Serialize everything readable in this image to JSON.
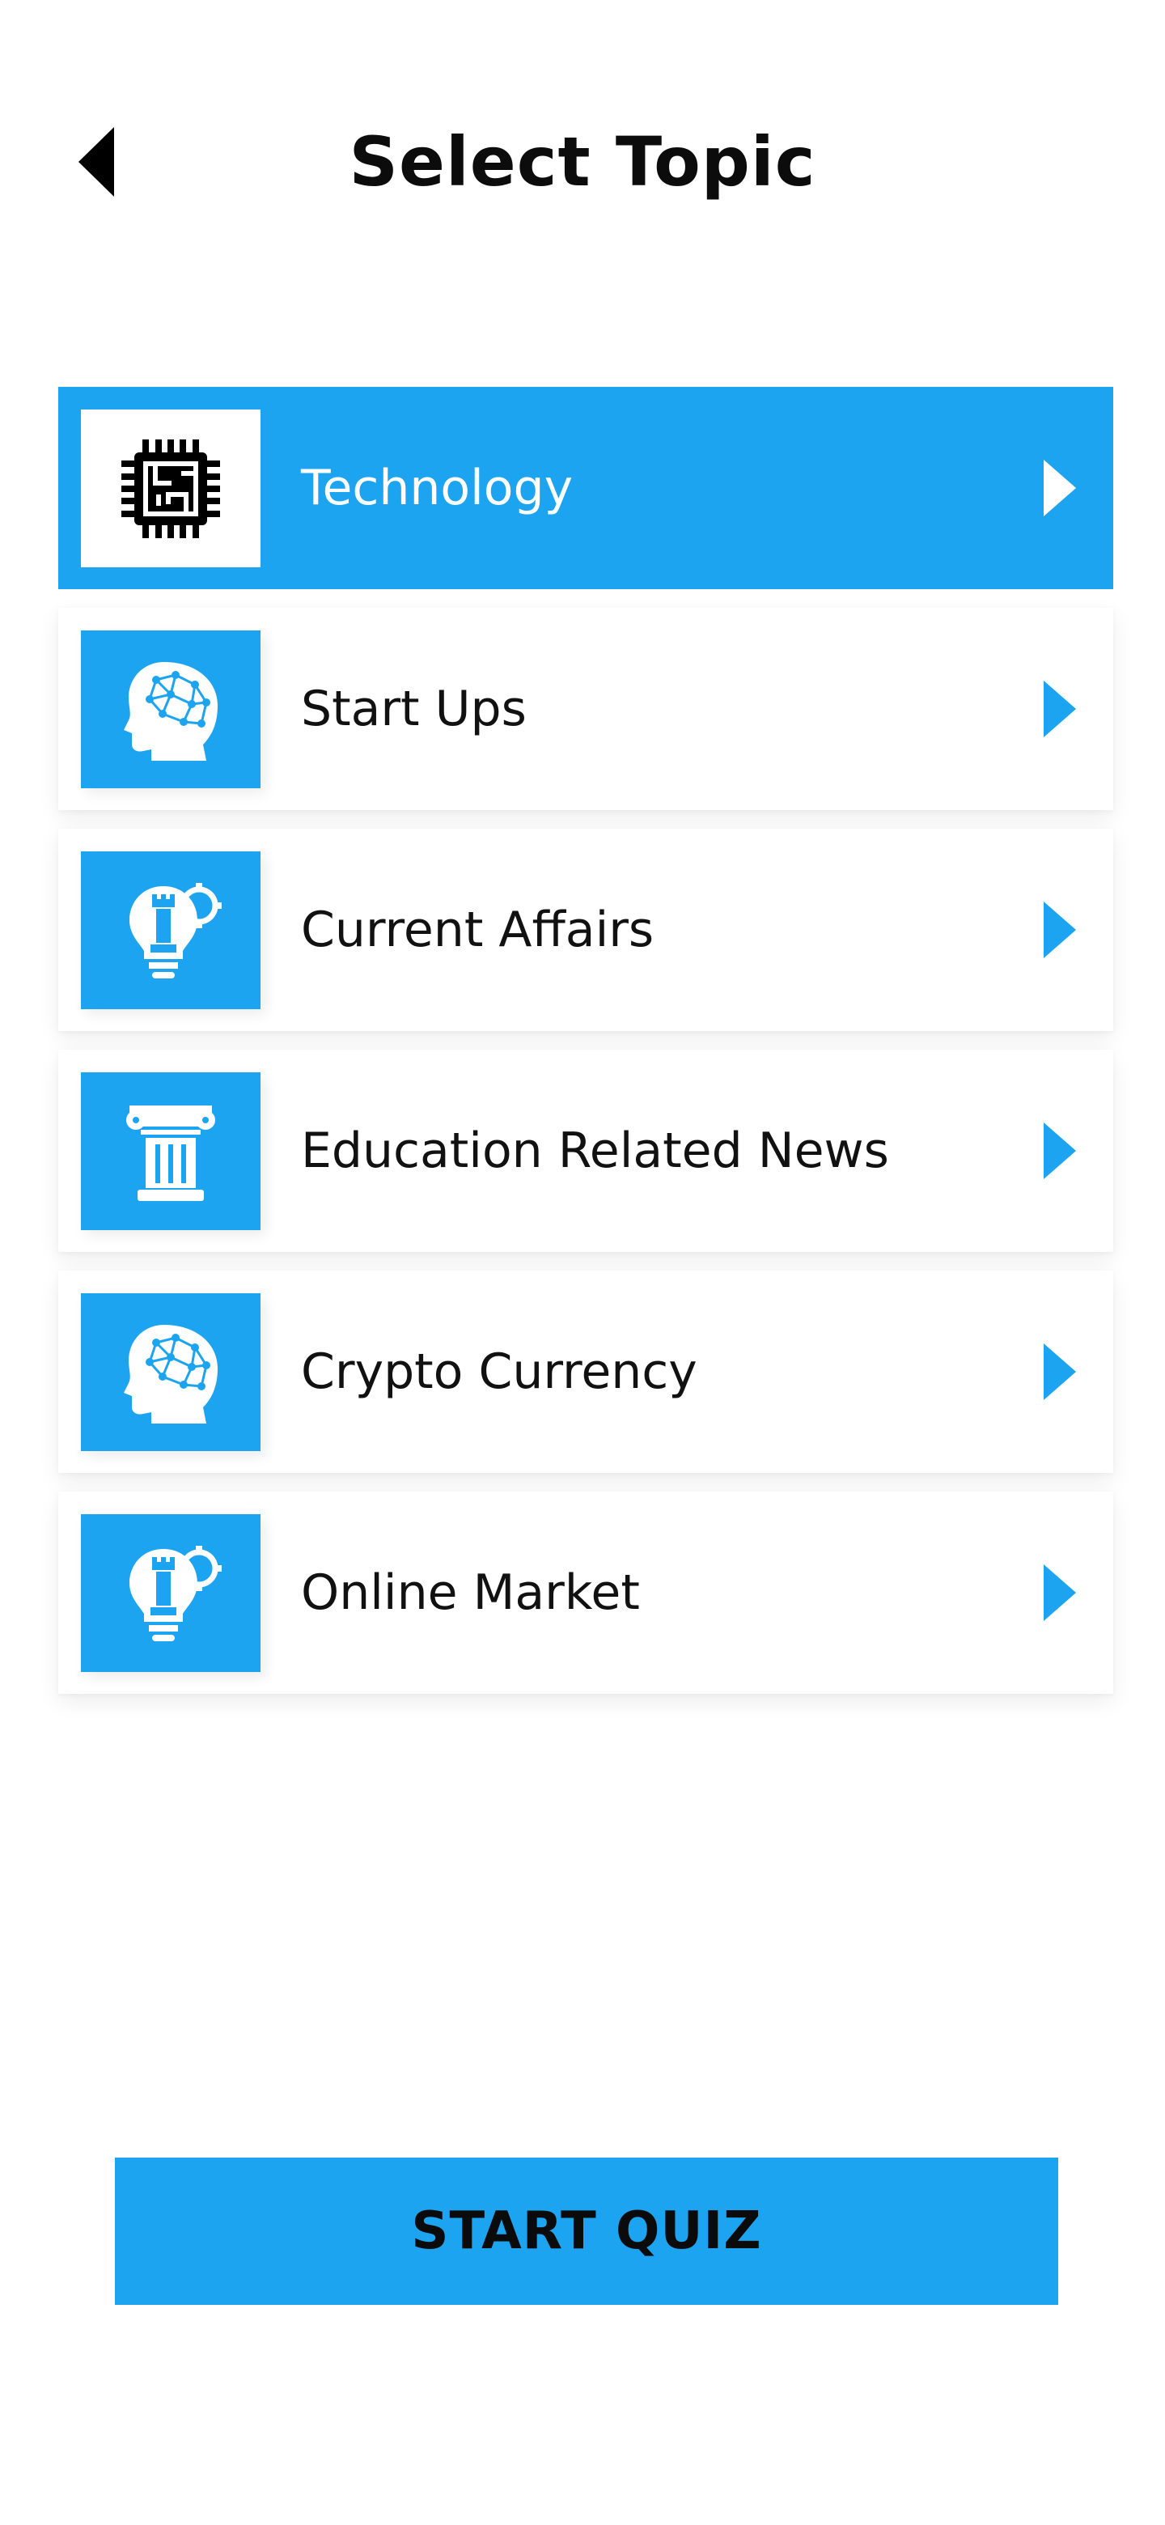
{
  "header": {
    "title": "Select Topic",
    "back_icon": "back-arrow-icon"
  },
  "topics": [
    {
      "label": "Technology",
      "icon": "cpu-chip-icon",
      "selected": true
    },
    {
      "label": "Start Ups",
      "icon": "brain-head-icon",
      "selected": false
    },
    {
      "label": "Current Affairs",
      "icon": "lightbulb-strategy-icon",
      "selected": false
    },
    {
      "label": "Education Related News",
      "icon": "column-pillar-icon",
      "selected": false
    },
    {
      "label": "Crypto Currency",
      "icon": "brain-head-icon",
      "selected": false
    },
    {
      "label": "Online Market",
      "icon": "lightbulb-strategy-icon",
      "selected": false
    }
  ],
  "footer": {
    "start_label": "START QUIZ"
  },
  "colors": {
    "accent": "#1ca4f1",
    "text": "#111111",
    "background": "#ffffff"
  }
}
